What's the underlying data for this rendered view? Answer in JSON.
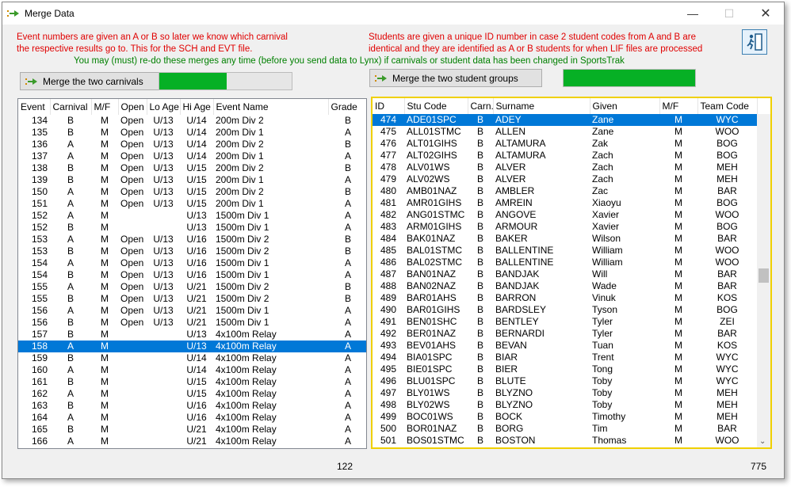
{
  "window": {
    "title": "Merge Data"
  },
  "notes": {
    "left_red": "Event numbers are given an A or B so later we know which carnival the respective results go to.  This for the SCH and EVT file.",
    "right_red": "Students are given a unique ID number in case 2 student codes from A and B are identical and they are identified as A or B students for when LIF files are processed",
    "green": "You may (must) re-do these merges any time (before you send data to Lynx) if carnivals or student data has been changed in SportsTrak"
  },
  "buttons": {
    "merge_carnivals": "Merge the two carnivals",
    "merge_students": "Merge the two student groups"
  },
  "progress": {
    "carnivals": 0.51,
    "students": 1.0
  },
  "colors": {
    "accent": "#0078d7",
    "progress": "#06b025",
    "note_red": "#e00000",
    "note_green": "#008000"
  },
  "events": {
    "columns": [
      "Event",
      "Carnival",
      "M/F",
      "Open",
      "Lo Age",
      "Hi Age",
      "Event Name",
      "Grade"
    ],
    "selected_index": 19,
    "rows": [
      [
        "134",
        "B",
        "M",
        "Open",
        "U/13",
        "U/14",
        "200m Div 2",
        "B"
      ],
      [
        "135",
        "B",
        "M",
        "Open",
        "U/13",
        "U/14",
        "200m Div 1",
        "A"
      ],
      [
        "136",
        "A",
        "M",
        "Open",
        "U/13",
        "U/14",
        "200m Div 2",
        "B"
      ],
      [
        "137",
        "A",
        "M",
        "Open",
        "U/13",
        "U/14",
        "200m Div 1",
        "A"
      ],
      [
        "138",
        "B",
        "M",
        "Open",
        "U/13",
        "U/15",
        "200m Div 2",
        "B"
      ],
      [
        "139",
        "B",
        "M",
        "Open",
        "U/13",
        "U/15",
        "200m Div 1",
        "A"
      ],
      [
        "150",
        "A",
        "M",
        "Open",
        "U/13",
        "U/15",
        "200m Div 2",
        "B"
      ],
      [
        "151",
        "A",
        "M",
        "Open",
        "U/13",
        "U/15",
        "200m Div 1",
        "A"
      ],
      [
        "152",
        "A",
        "M",
        "",
        "",
        "U/13",
        "1500m Div 1",
        "A"
      ],
      [
        "152",
        "B",
        "M",
        "",
        "",
        "U/13",
        "1500m Div 1",
        "A"
      ],
      [
        "153",
        "A",
        "M",
        "Open",
        "U/13",
        "U/16",
        "1500m Div 2",
        "B"
      ],
      [
        "153",
        "B",
        "M",
        "Open",
        "U/13",
        "U/16",
        "1500m Div 2",
        "B"
      ],
      [
        "154",
        "A",
        "M",
        "Open",
        "U/13",
        "U/16",
        "1500m Div 1",
        "A"
      ],
      [
        "154",
        "B",
        "M",
        "Open",
        "U/13",
        "U/16",
        "1500m Div 1",
        "A"
      ],
      [
        "155",
        "A",
        "M",
        "Open",
        "U/13",
        "U/21",
        "1500m Div 2",
        "B"
      ],
      [
        "155",
        "B",
        "M",
        "Open",
        "U/13",
        "U/21",
        "1500m Div 2",
        "B"
      ],
      [
        "156",
        "A",
        "M",
        "Open",
        "U/13",
        "U/21",
        "1500m Div 1",
        "A"
      ],
      [
        "156",
        "B",
        "M",
        "Open",
        "U/13",
        "U/21",
        "1500m Div 1",
        "A"
      ],
      [
        "157",
        "B",
        "M",
        "",
        "",
        "U/13",
        "4x100m Relay",
        "A"
      ],
      [
        "158",
        "A",
        "M",
        "",
        "",
        "U/13",
        "4x100m Relay",
        "A"
      ],
      [
        "159",
        "B",
        "M",
        "",
        "",
        "U/14",
        "4x100m Relay",
        "A"
      ],
      [
        "160",
        "A",
        "M",
        "",
        "",
        "U/14",
        "4x100m Relay",
        "A"
      ],
      [
        "161",
        "B",
        "M",
        "",
        "",
        "U/15",
        "4x100m Relay",
        "A"
      ],
      [
        "162",
        "A",
        "M",
        "",
        "",
        "U/15",
        "4x100m Relay",
        "A"
      ],
      [
        "163",
        "B",
        "M",
        "",
        "",
        "U/16",
        "4x100m Relay",
        "A"
      ],
      [
        "164",
        "A",
        "M",
        "",
        "",
        "U/16",
        "4x100m Relay",
        "A"
      ],
      [
        "165",
        "B",
        "M",
        "",
        "",
        "U/21",
        "4x100m Relay",
        "A"
      ],
      [
        "166",
        "A",
        "M",
        "",
        "",
        "U/21",
        "4x100m Relay",
        "A"
      ]
    ],
    "count": "122"
  },
  "students": {
    "columns": [
      "ID",
      "Stu Code",
      "Carn.",
      "Surname",
      "Given",
      "M/F",
      "Team Code"
    ],
    "selected_index": 0,
    "rows": [
      [
        "474",
        "ADE01SPC",
        "B",
        "ADEY",
        "Zane",
        "M",
        "WYC"
      ],
      [
        "475",
        "ALL01STMC",
        "B",
        "ALLEN",
        "Zane",
        "M",
        "WOO"
      ],
      [
        "476",
        "ALT01GIHS",
        "B",
        "ALTAMURA",
        "Zak",
        "M",
        "BOG"
      ],
      [
        "477",
        "ALT02GIHS",
        "B",
        "ALTAMURA",
        "Zach",
        "M",
        "BOG"
      ],
      [
        "478",
        "ALV01WS",
        "B",
        "ALVER",
        "Zach",
        "M",
        "MEH"
      ],
      [
        "479",
        "ALV02WS",
        "B",
        "ALVER",
        "Zach",
        "M",
        "MEH"
      ],
      [
        "480",
        "AMB01NAZ",
        "B",
        "AMBLER",
        "Zac",
        "M",
        "BAR"
      ],
      [
        "481",
        "AMR01GIHS",
        "B",
        "AMREIN",
        "Xiaoyu",
        "M",
        "BOG"
      ],
      [
        "482",
        "ANG01STMC",
        "B",
        "ANGOVE",
        "Xavier",
        "M",
        "WOO"
      ],
      [
        "483",
        "ARM01GIHS",
        "B",
        "ARMOUR",
        "Xavier",
        "M",
        "BOG"
      ],
      [
        "484",
        "BAK01NAZ",
        "B",
        "BAKER",
        "Wilson",
        "M",
        "BAR"
      ],
      [
        "485",
        "BAL01STMC",
        "B",
        "BALLENTINE",
        "William",
        "M",
        "WOO"
      ],
      [
        "486",
        "BAL02STMC",
        "B",
        "BALLENTINE",
        "William",
        "M",
        "WOO"
      ],
      [
        "487",
        "BAN01NAZ",
        "B",
        "BANDJAK",
        "Will",
        "M",
        "BAR"
      ],
      [
        "488",
        "BAN02NAZ",
        "B",
        "BANDJAK",
        "Wade",
        "M",
        "BAR"
      ],
      [
        "489",
        "BAR01AHS",
        "B",
        "BARRON",
        "Vinuk",
        "M",
        "KOS"
      ],
      [
        "490",
        "BAR01GIHS",
        "B",
        "BARDSLEY",
        "Tyson",
        "M",
        "BOG"
      ],
      [
        "491",
        "BEN01SHC",
        "B",
        "BENTLEY",
        "Tyler",
        "M",
        "ZEI"
      ],
      [
        "492",
        "BER01NAZ",
        "B",
        "BERNARDI",
        "Tyler",
        "M",
        "BAR"
      ],
      [
        "493",
        "BEV01AHS",
        "B",
        "BEVAN",
        "Tuan",
        "M",
        "KOS"
      ],
      [
        "494",
        "BIA01SPC",
        "B",
        "BIAR",
        "Trent",
        "M",
        "WYC"
      ],
      [
        "495",
        "BIE01SPC",
        "B",
        "BIER",
        "Tong",
        "M",
        "WYC"
      ],
      [
        "496",
        "BLU01SPC",
        "B",
        "BLUTE",
        "Toby",
        "M",
        "WYC"
      ],
      [
        "497",
        "BLY01WS",
        "B",
        "BLYZNO",
        "Toby",
        "M",
        "MEH"
      ],
      [
        "498",
        "BLY02WS",
        "B",
        "BLYZNO",
        "Toby",
        "M",
        "MEH"
      ],
      [
        "499",
        "BOC01WS",
        "B",
        "BOCK",
        "Timothy",
        "M",
        "MEH"
      ],
      [
        "500",
        "BOR01NAZ",
        "B",
        "BORG",
        "Tim",
        "M",
        "BAR"
      ],
      [
        "501",
        "BOS01STMC",
        "B",
        "BOSTON",
        "Thomas",
        "M",
        "WOO"
      ]
    ],
    "count": "775"
  }
}
